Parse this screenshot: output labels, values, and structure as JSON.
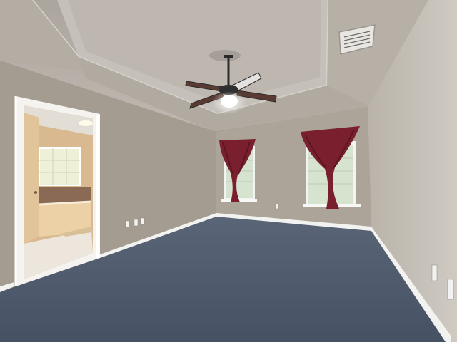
{
  "scene": {
    "colors": {
      "ceiling": "#b8b2aa",
      "tray": "#c7c2bb",
      "wall_left": "#a79f94",
      "wall_back": "#aaa296",
      "wall_right": "#c2bcb3",
      "carpet": "#4e5a6c",
      "baseboard": "#f2f2f0",
      "curtain": "#7a1f2e",
      "window_glass": "#d7e4d0",
      "bath_wall": "#d8b88e",
      "bath_floor": "#ece6dc"
    },
    "objects": [
      "ceiling-fan",
      "air-vent",
      "left-window-curtain",
      "right-window-curtain",
      "open-doorway-to-bathroom",
      "electrical-outlets"
    ]
  }
}
